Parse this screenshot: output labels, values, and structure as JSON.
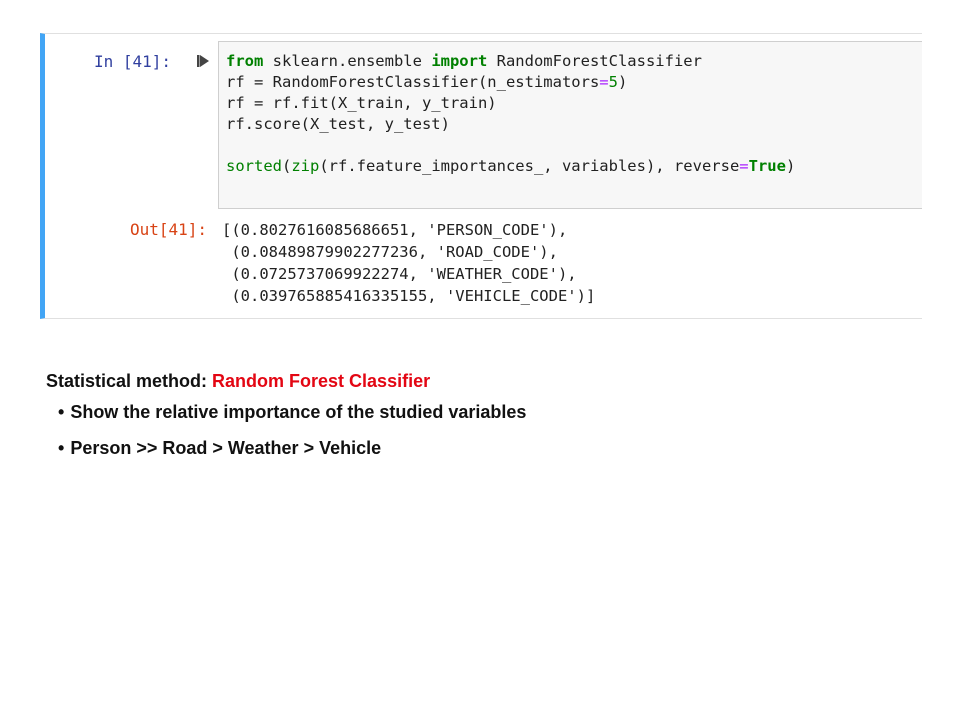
{
  "cell": {
    "in_prompt": "In [41]:",
    "out_prompt": "Out[41]:",
    "code": {
      "line1": {
        "kw1": "from",
        "t1": " sklearn.ensemble ",
        "kw2": "import",
        "t2": " RandomForestClassifier"
      },
      "line2": {
        "t1": "rf = RandomForestClassifier(n_estimators",
        "op": "=",
        "num": "5",
        "t2": ")"
      },
      "line3": {
        "text": "rf = rf.fit(X_train, y_train)"
      },
      "line4": {
        "text": "rf.score(X_test, y_test)"
      },
      "line6": {
        "bi1": "sorted",
        "t1": "(",
        "bi2": "zip",
        "t2": "(rf.feature_importances_, variables), reverse",
        "op": "=",
        "kw": "True",
        "t3": ")"
      }
    },
    "output": [
      "[(0.8027616085686651, 'PERSON_CODE'),",
      " (0.08489879902277236, 'ROAD_CODE'),",
      " (0.0725737069922274, 'WEATHER_CODE'),",
      " (0.039765885416335155, 'VEHICLE_CODE')]"
    ]
  },
  "notes": {
    "heading_prefix": "Statistical method: ",
    "heading_method": "Random Forest Classifier",
    "bullet_char": "•",
    "bullets": [
      "Show the relative importance of the studied variables",
      "Person >> Road > Weather > Vehicle"
    ]
  },
  "colors": {
    "cell_border_accent": "#42a5f5",
    "in_prompt": "#303f9f",
    "out_prompt": "#d84315",
    "keyword": "#008000",
    "operator": "#aa22ff",
    "method_highlight": "#e30613"
  },
  "icons": {
    "run_marker": "run-cell-icon"
  }
}
